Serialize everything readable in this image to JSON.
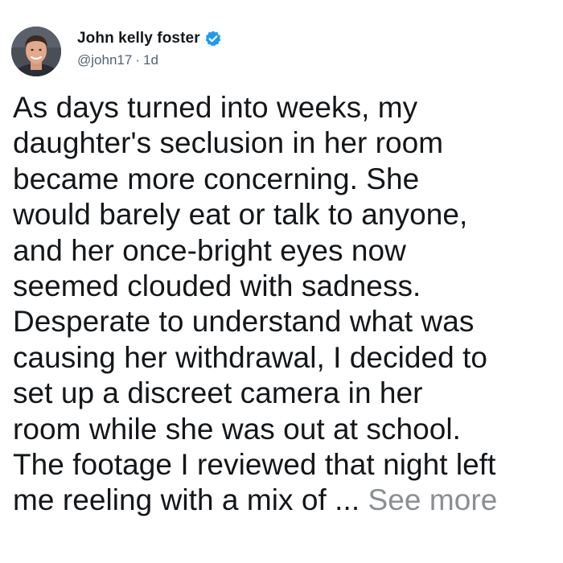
{
  "post": {
    "author": {
      "display_name": "John kelly foster",
      "handle": "@john17",
      "separator": "·",
      "time": "1d",
      "verified_icon": "verified-badge-icon",
      "verified_color": "#1d9bf0"
    },
    "body_lines": [
      "As days turned into weeks, my",
      "daughter's seclusion in her room",
      "became more concerning. She",
      "would barely eat or talk to anyone,",
      "and her once-bright eyes now",
      "seemed clouded with sadness.",
      "Desperate to understand what was",
      "causing her withdrawal, I decided to",
      "set up a discreet camera in her",
      "room while she was out at school.",
      "The footage I reviewed that night left",
      "me reeling with a mix of ..."
    ],
    "see_more_label": "See more"
  }
}
